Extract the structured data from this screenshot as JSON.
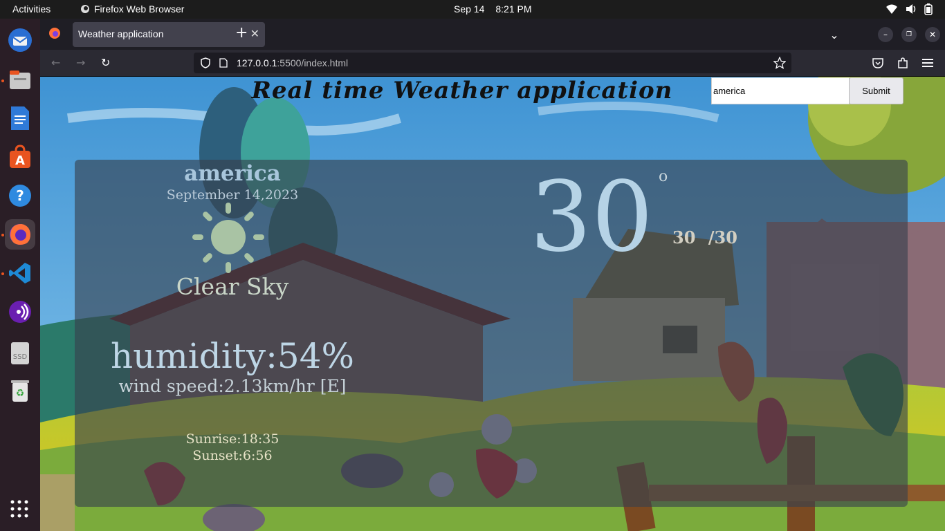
{
  "system": {
    "activities": "Activities",
    "app_name": "Firefox Web Browser",
    "date": "Sep 14",
    "time": "8:21 PM"
  },
  "dock": {
    "items": [
      "thunderbird",
      "files",
      "libreoffice-writer",
      "app-center",
      "help",
      "firefox",
      "vscode",
      "podcasts",
      "ssd-drive",
      "trash"
    ],
    "ssd_label": "SSD",
    "active_item": "firefox"
  },
  "browser": {
    "tab_title": "Weather application",
    "url_host": "127.0.0.1",
    "url_rest": ":5500/index.html"
  },
  "page": {
    "title": "Real time Weather application",
    "search_value": "america",
    "submit_label": "Submit"
  },
  "weather": {
    "city": "america",
    "date": "September 14,2023",
    "description": "Clear Sky",
    "temperature": "30",
    "degree_symbol": "o",
    "min_max": "30 /30",
    "humidity": "humidity:54%",
    "wind": "wind speed:2.13km/hr [E]",
    "sunrise": "Sunrise:18:35",
    "sunset": "Sunset:6:56"
  },
  "colors": {
    "card_overlay": "#37414e",
    "accent_orange": "#e95420",
    "sky": "#5aa8dc"
  }
}
